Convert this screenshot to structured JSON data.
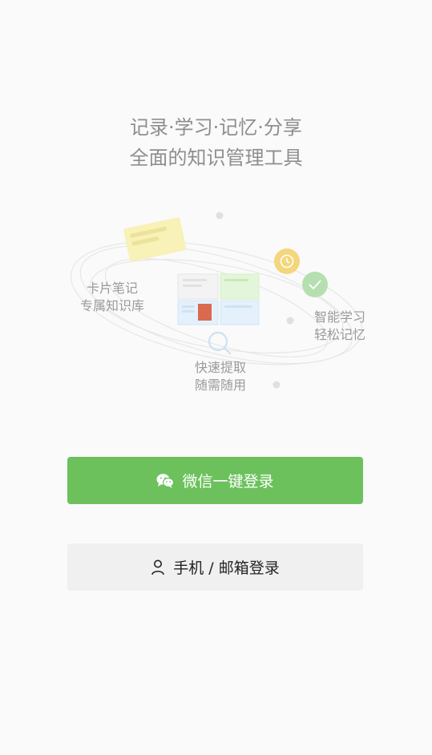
{
  "hero": {
    "line1": "记录·学习·记忆·分享",
    "line2": "全面的知识管理工具"
  },
  "illustration": {
    "left_label_1": "卡片笔记",
    "left_label_2": "专属知识库",
    "right_label_1": "智能学习",
    "right_label_2": "轻松记忆",
    "bottom_label_1": "快速提取",
    "bottom_label_2": "随需随用"
  },
  "buttons": {
    "wechat_label": "微信一键登录",
    "wechat_icon": "wechat-icon",
    "phone_label": "手机 / 邮箱登录",
    "phone_icon": "user-icon"
  },
  "colors": {
    "primary": "#6cc15d",
    "background": "#fafafa",
    "secondary_button": "#f0f0f0"
  }
}
